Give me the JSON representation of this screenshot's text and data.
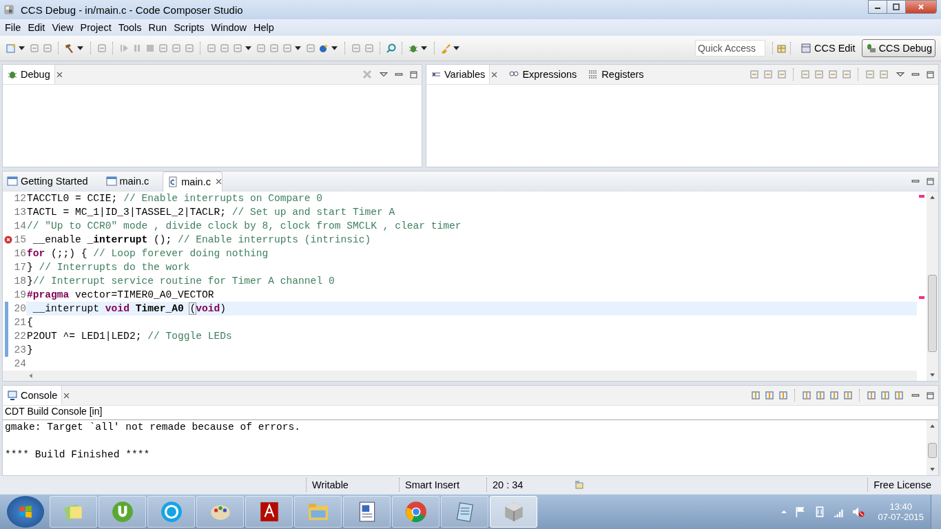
{
  "window": {
    "title": "CCS Debug - in/main.c - Code Composer Studio"
  },
  "menu": [
    "File",
    "Edit",
    "View",
    "Project",
    "Tools",
    "Run",
    "Scripts",
    "Window",
    "Help"
  ],
  "toolbar": {
    "quick_access": {
      "placeholder": "Quick Access"
    },
    "perspectives": [
      {
        "label": "CCS Edit",
        "selected": false
      },
      {
        "label": "CCS Debug",
        "selected": true
      }
    ]
  },
  "debug_view": {
    "tab": "Debug"
  },
  "variables_view": {
    "tabs": [
      {
        "label": "Variables",
        "kind": "variables",
        "selected": true
      },
      {
        "label": "Expressions",
        "kind": "expressions",
        "selected": false
      },
      {
        "label": "Registers",
        "kind": "registers",
        "selected": false
      }
    ]
  },
  "editor": {
    "tabs": [
      {
        "label": "Getting Started",
        "kind": "page",
        "selected": false
      },
      {
        "label": "main.c",
        "kind": "page",
        "selected": false
      },
      {
        "label": "main.c",
        "kind": "c",
        "selected": true
      }
    ],
    "lines": [
      {
        "number": "12",
        "error": false,
        "changed": false,
        "current": false,
        "segments": [
          {
            "kind": "plain",
            "text": "TACCTL0 = CCIE; "
          },
          {
            "kind": "comment",
            "text": "// Enable interrupts on Compare 0"
          }
        ]
      },
      {
        "number": "13",
        "error": false,
        "changed": false,
        "current": false,
        "segments": [
          {
            "kind": "plain",
            "text": "TACTL = MC_1|ID_3|TASSEL_2|TACLR; "
          },
          {
            "kind": "comment",
            "text": "// Set up and start Timer A"
          }
        ]
      },
      {
        "number": "14",
        "error": false,
        "changed": false,
        "current": false,
        "segments": [
          {
            "kind": "comment",
            "text": "// \"Up to CCR0\" mode , divide clock by 8, clock from SMCLK , clear timer"
          }
        ]
      },
      {
        "number": "15",
        "error": true,
        "changed": false,
        "current": false,
        "segments": [
          {
            "kind": "plain",
            "text": " __enable "
          },
          {
            "kind": "bold",
            "text": "_interrupt"
          },
          {
            "kind": "plain",
            "text": " (); "
          },
          {
            "kind": "comment",
            "text": "// Enable interrupts (intrinsic)"
          }
        ]
      },
      {
        "number": "16",
        "error": false,
        "changed": false,
        "current": false,
        "segments": [
          {
            "kind": "keyword",
            "text": "for"
          },
          {
            "kind": "plain",
            "text": " (;;) { "
          },
          {
            "kind": "comment",
            "text": "// Loop forever doing nothing"
          }
        ]
      },
      {
        "number": "17",
        "error": false,
        "changed": false,
        "current": false,
        "segments": [
          {
            "kind": "plain",
            "text": "} "
          },
          {
            "kind": "comment",
            "text": "// Interrupts do the work"
          }
        ]
      },
      {
        "number": "18",
        "error": false,
        "changed": false,
        "current": false,
        "segments": [
          {
            "kind": "plain",
            "text": "}"
          },
          {
            "kind": "comment",
            "text": "// Interrupt service routine for Timer A channel 0"
          }
        ]
      },
      {
        "number": "19",
        "error": false,
        "changed": false,
        "current": false,
        "segments": [
          {
            "kind": "keyword",
            "text": "#pragma"
          },
          {
            "kind": "plain",
            "text": " vector=TIMER0_A0_VECTOR"
          }
        ]
      },
      {
        "number": "20",
        "error": false,
        "changed": true,
        "current": true,
        "segments": [
          {
            "kind": "plain",
            "text": " __interrupt "
          },
          {
            "kind": "keyword",
            "text": "void"
          },
          {
            "kind": "bold",
            "text": " Timer_A0 "
          },
          {
            "kind": "bracket",
            "text": "("
          },
          {
            "kind": "keyword",
            "text": "void"
          },
          {
            "kind": "plain",
            "text": ")"
          }
        ]
      },
      {
        "number": "21",
        "error": false,
        "changed": true,
        "current": false,
        "segments": [
          {
            "kind": "plain",
            "text": "{"
          }
        ]
      },
      {
        "number": "22",
        "error": false,
        "changed": true,
        "current": false,
        "segments": [
          {
            "kind": "plain",
            "text": "P2OUT ^= LED1|LED2; "
          },
          {
            "kind": "comment",
            "text": "// Toggle LEDs"
          }
        ]
      },
      {
        "number": "23",
        "error": false,
        "changed": true,
        "current": false,
        "segments": [
          {
            "kind": "plain",
            "text": "}"
          }
        ]
      },
      {
        "number": "24",
        "error": false,
        "changed": false,
        "current": false
      }
    ]
  },
  "console": {
    "tab": "Console",
    "title": "CDT Build Console [in]",
    "lines": [
      "gmake: Target `all' not remade because of errors.",
      "**** Build Finished ****"
    ]
  },
  "status_bar": [
    "Writable",
    "Smart Insert",
    "20 : 34",
    "Free License"
  ],
  "taskbar": {
    "apps": [
      {
        "kind": "notes",
        "selected": false
      },
      {
        "kind": "torrent",
        "selected": false
      },
      {
        "kind": "phone",
        "selected": false
      },
      {
        "kind": "paint",
        "selected": false
      },
      {
        "kind": "pdf",
        "selected": false
      },
      {
        "kind": "folder",
        "selected": false
      },
      {
        "kind": "document",
        "selected": false
      },
      {
        "kind": "browser",
        "selected": false
      },
      {
        "kind": "notepad",
        "selected": false
      },
      {
        "kind": "cube",
        "selected": true
      }
    ],
    "clock": {
      "time": "13:40",
      "date": "07-07-2015"
    }
  }
}
